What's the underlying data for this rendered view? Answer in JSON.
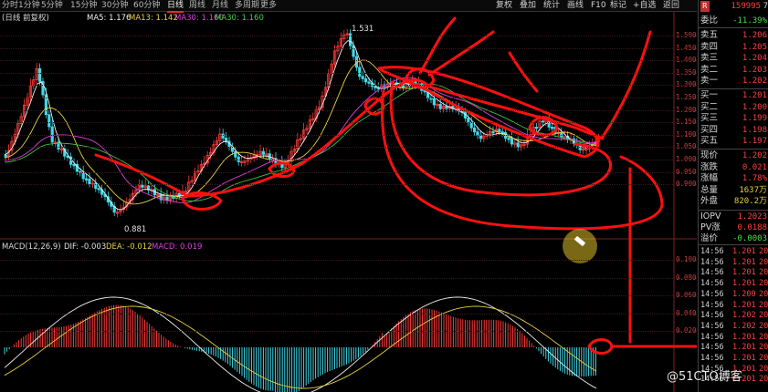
{
  "toolbar": {
    "periods": [
      "分时",
      "1分钟",
      "5分钟",
      "15分钟",
      "30分钟",
      "60分钟",
      "日线",
      "周线",
      "月线",
      "多周期",
      "更多"
    ],
    "active_period": "日线",
    "tools": [
      "复权",
      "叠加",
      "统计",
      "画线",
      "F10",
      "标记",
      "+自选",
      "返回"
    ],
    "header_code": "159995",
    "header_tail": "7"
  },
  "kline_legend": {
    "label": "(日线 前复权)",
    "ma5": "MA5: 1.176",
    "ma13": "MA13: 1.142",
    "ma30a": "MA30: 1.160",
    "ma30b": "MA30: 1.160"
  },
  "price_axis": [
    "1.500",
    "1.450",
    "1.400",
    "1.350",
    "1.300",
    "1.250",
    "1.200",
    "1.150",
    "1.100",
    "1.050",
    "1.000",
    "0.950",
    "0.900"
  ],
  "annotations": {
    "high": "1.531",
    "low": "0.881"
  },
  "macd_legend": {
    "label": "MACD(12,26,9)",
    "dif": "DIF: -0.003",
    "dea": "DEA: -0.012",
    "macd": "MACD: 0.019"
  },
  "macd_axis": [
    "0.100",
    "0.080",
    "0.060",
    "0.040",
    "0.020"
  ],
  "side_panel": {
    "weibi": {
      "label": "委比",
      "value": "-11.39%"
    },
    "asks": [
      {
        "label": "卖五",
        "value": "1.206"
      },
      {
        "label": "卖四",
        "value": "1.205"
      },
      {
        "label": "卖三",
        "value": "1.204"
      },
      {
        "label": "卖二",
        "value": "1.203"
      },
      {
        "label": "卖一",
        "value": "1.202"
      }
    ],
    "bids": [
      {
        "label": "买一",
        "value": "1.201"
      },
      {
        "label": "买二",
        "value": "1.200"
      },
      {
        "label": "买三",
        "value": "1.199"
      },
      {
        "label": "买四",
        "value": "1.198"
      },
      {
        "label": "买五",
        "value": "1.197"
      }
    ],
    "stats": [
      {
        "label": "现价",
        "value": "1.202"
      },
      {
        "label": "涨跌",
        "value": "0.021"
      },
      {
        "label": "涨幅",
        "value": "1.78%"
      },
      {
        "label": "总量",
        "value": "1637万"
      },
      {
        "label": "外盘",
        "value": "820.2万"
      }
    ],
    "iopv": [
      {
        "label": "IOPV",
        "value": "1.2023"
      },
      {
        "label": "PV涨",
        "value": "0.0188"
      },
      {
        "label": "溢价",
        "value": "-0.0003"
      }
    ],
    "ticks": [
      {
        "time": "14:56",
        "price": "1.201",
        "vol": "20"
      },
      {
        "time": "14:56",
        "price": "1.201",
        "vol": "20"
      },
      {
        "time": "14:56",
        "price": "1.201",
        "vol": "20"
      },
      {
        "time": "14:56",
        "price": "1.201",
        "vol": "20"
      },
      {
        "time": "14:56",
        "price": "1.200",
        "vol": "20"
      },
      {
        "time": "14:56",
        "price": "1.201",
        "vol": "20"
      },
      {
        "time": "14:56",
        "price": "1.202",
        "vol": "20"
      },
      {
        "time": "14:56",
        "price": "1.202",
        "vol": "20"
      },
      {
        "time": "14:56",
        "price": "1.201",
        "vol": "20"
      },
      {
        "time": "14:56",
        "price": "1.201",
        "vol": "20"
      },
      {
        "time": "14:56",
        "price": "1.201",
        "vol": "20"
      },
      {
        "time": "14:56",
        "price": "1.201",
        "vol": "20"
      },
      {
        "time": "14:56",
        "price": "1.201",
        "vol": "20"
      }
    ]
  },
  "watermark": "@51CTO博客"
}
